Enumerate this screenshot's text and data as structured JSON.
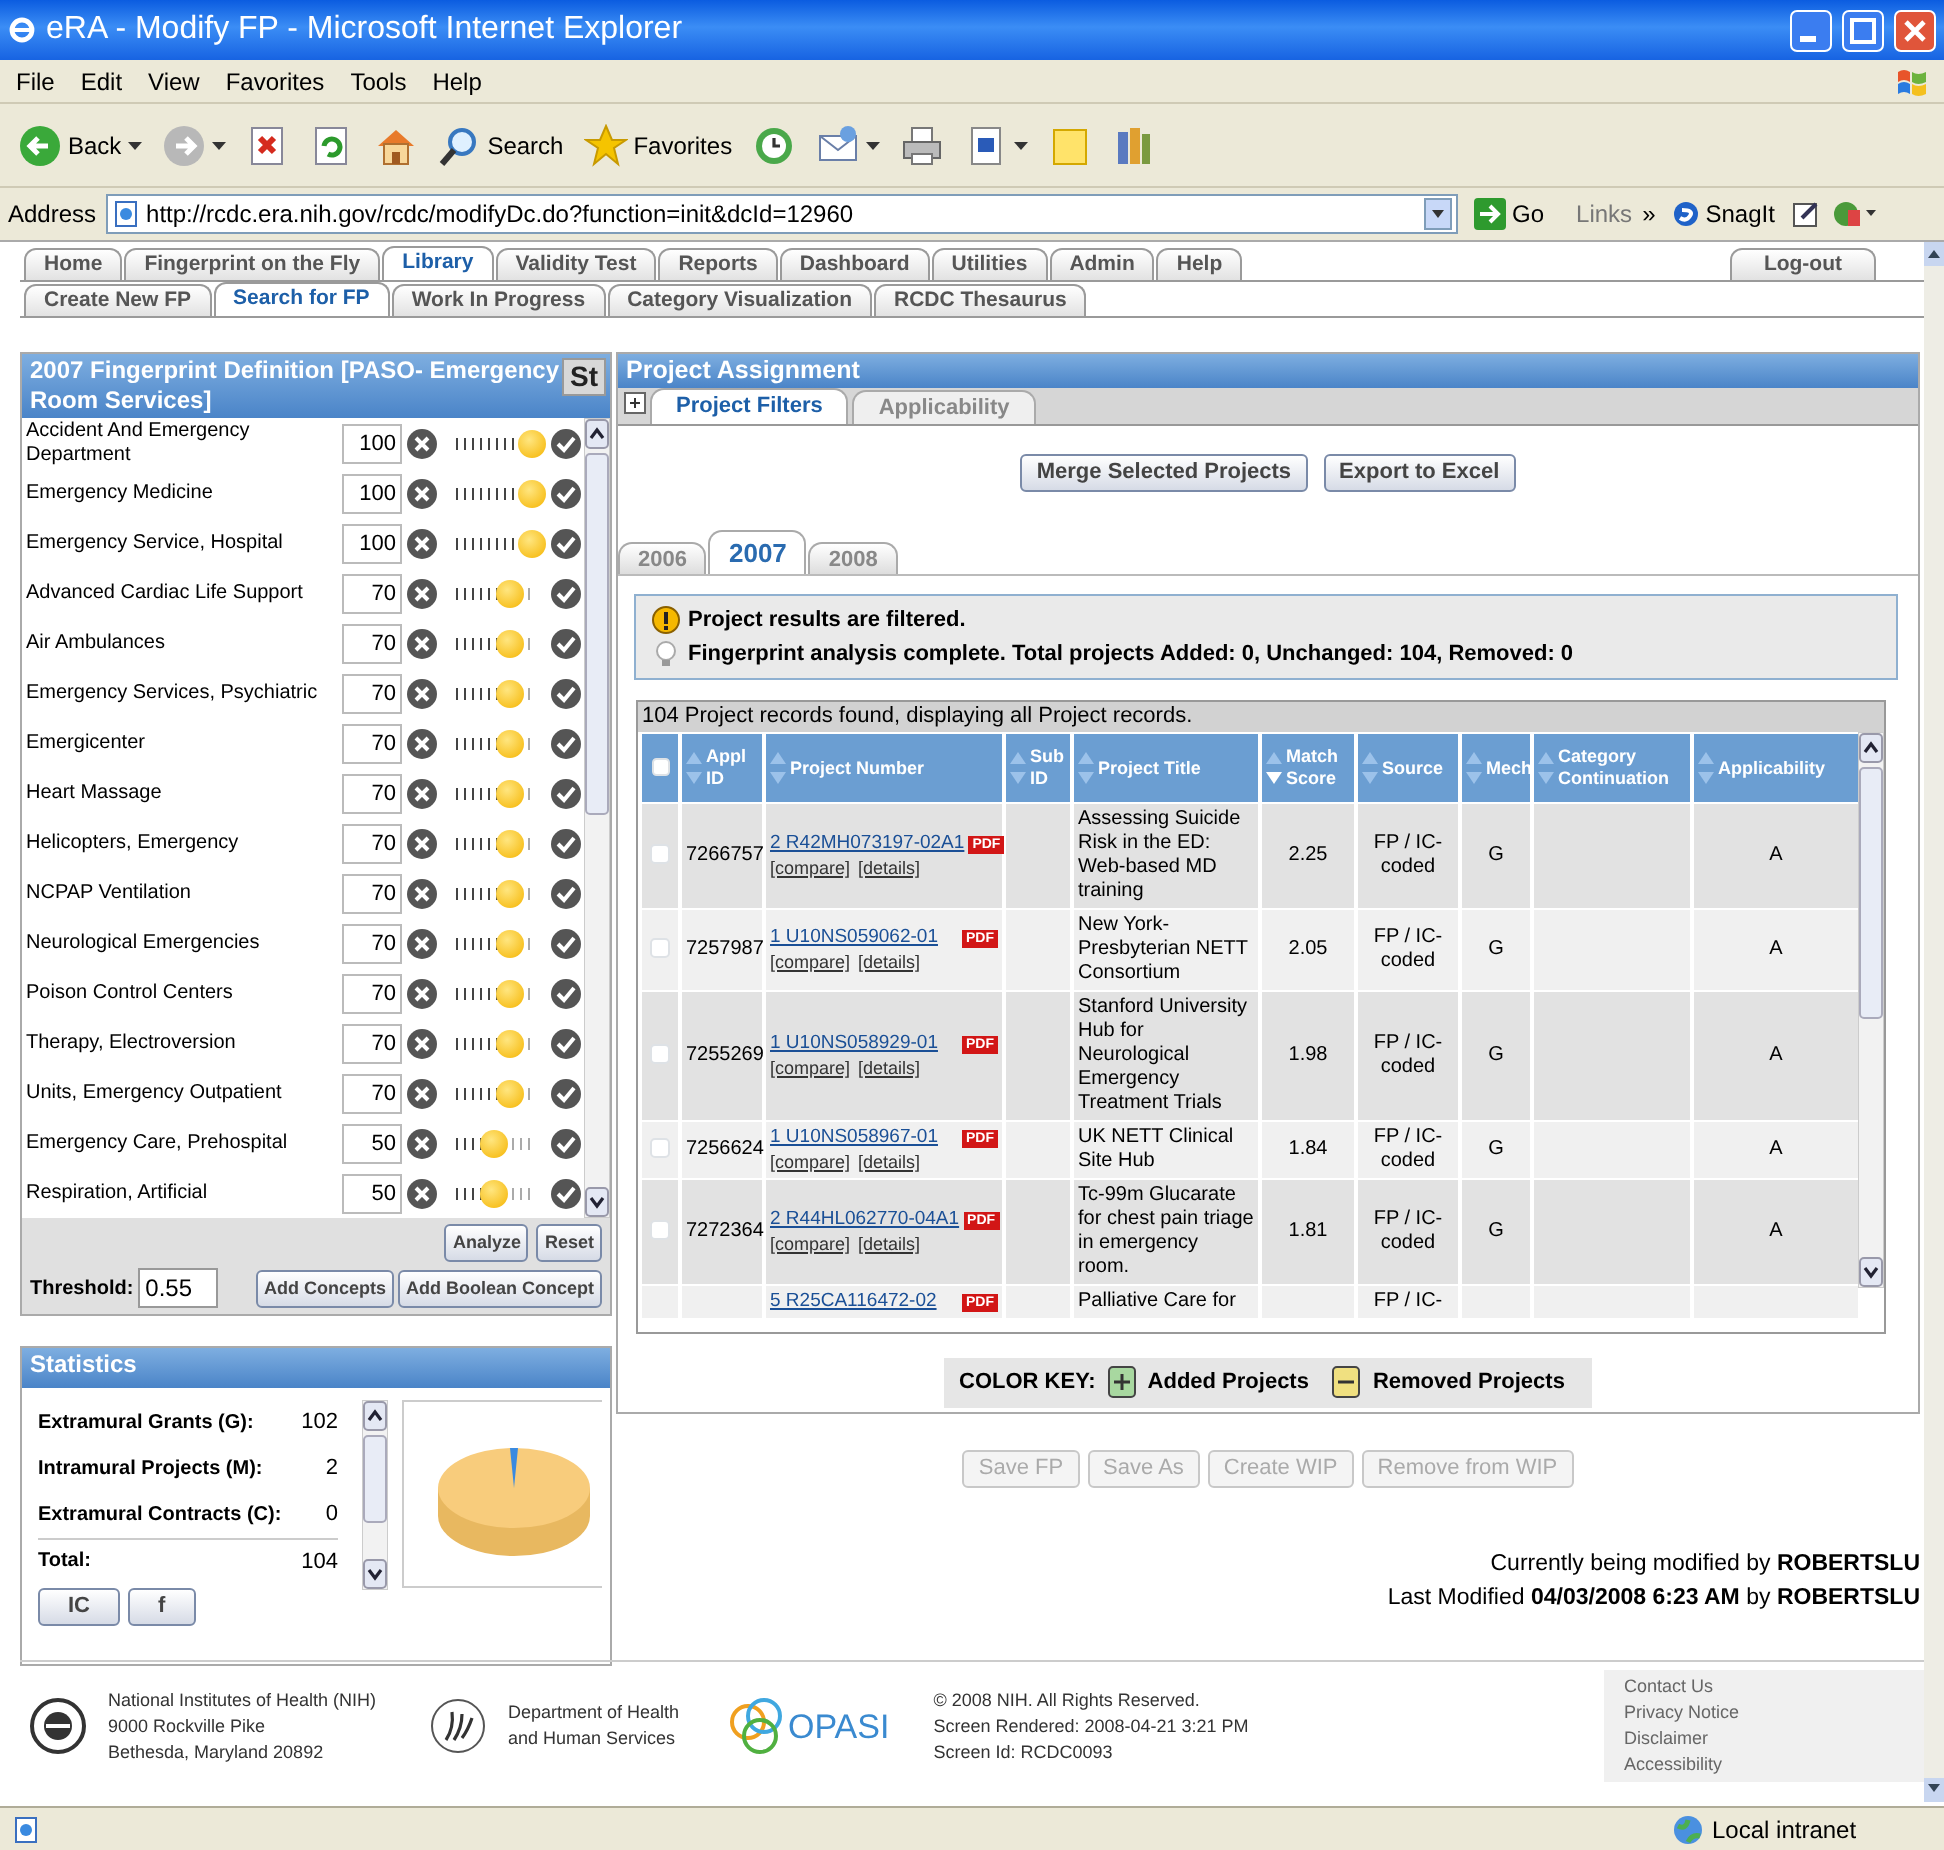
{
  "window": {
    "title": "eRA - Modify FP - Microsoft Internet Explorer"
  },
  "menu": [
    "File",
    "Edit",
    "View",
    "Favorites",
    "Tools",
    "Help"
  ],
  "toolbar": [
    {
      "kind": "back",
      "label": "Back",
      "menu": true
    },
    {
      "kind": "forward",
      "menu": true
    },
    {
      "kind": "stop",
      "menu": false
    },
    {
      "kind": "refresh",
      "menu": false
    },
    {
      "kind": "home",
      "menu": false
    },
    {
      "kind": "search",
      "label": "Search",
      "menu": false
    },
    {
      "kind": "favorites",
      "label": "Favorites",
      "menu": false
    },
    {
      "kind": "history",
      "menu": false
    },
    {
      "kind": "mail",
      "menu": true
    },
    {
      "kind": "print",
      "menu": false
    },
    {
      "kind": "word",
      "menu": true
    },
    {
      "kind": "note",
      "menu": false
    },
    {
      "kind": "research",
      "menu": false
    }
  ],
  "address": {
    "label": "Address",
    "url": "http://rcdc.era.nih.gov/rcdc/modifyDc.do?function=init&dcId=12960",
    "go": "Go",
    "links": "Links",
    "chevron": "»",
    "snagit": "SnagIt"
  },
  "nav_tabs": [
    {
      "label": "Home",
      "selected": false
    },
    {
      "label": "Fingerprint on the Fly",
      "selected": false
    },
    {
      "label": "Library",
      "selected": true
    },
    {
      "label": "Validity Test",
      "selected": false
    },
    {
      "label": "Reports",
      "selected": false
    },
    {
      "label": "Dashboard",
      "selected": false
    },
    {
      "label": "Utilities",
      "selected": false
    },
    {
      "label": "Admin",
      "selected": false
    },
    {
      "label": "Help",
      "selected": false
    }
  ],
  "logout": "Log-out",
  "sub_tabs": [
    {
      "label": "Create New FP",
      "selected": false
    },
    {
      "label": "Search for FP",
      "selected": true
    },
    {
      "label": "Work In Progress",
      "selected": false
    },
    {
      "label": "Category Visualization",
      "selected": false
    },
    {
      "label": "RCDC Thesaurus",
      "selected": false
    }
  ],
  "fingerprint": {
    "title": "2007 Fingerprint Definition [PASO- Emergency Room Services]",
    "side_button": "St",
    "concepts": [
      {
        "name": "Accident And Emergency Department",
        "value": "100",
        "level": 1
      },
      {
        "name": "Emergency Medicine",
        "value": "100",
        "level": 1
      },
      {
        "name": "Emergency Service, Hospital",
        "value": "100",
        "level": 1
      },
      {
        "name": "Advanced Cardiac Life Support",
        "value": "70",
        "level": 0.7
      },
      {
        "name": "Air Ambulances",
        "value": "70",
        "level": 0.7
      },
      {
        "name": "Emergency Services, Psychiatric",
        "value": "70",
        "level": 0.7
      },
      {
        "name": "Emergicenter",
        "value": "70",
        "level": 0.7
      },
      {
        "name": "Heart Massage",
        "value": "70",
        "level": 0.7
      },
      {
        "name": "Helicopters, Emergency",
        "value": "70",
        "level": 0.7
      },
      {
        "name": "NCPAP Ventilation",
        "value": "70",
        "level": 0.7
      },
      {
        "name": "Neurological Emergencies",
        "value": "70",
        "level": 0.7
      },
      {
        "name": "Poison Control Centers",
        "value": "70",
        "level": 0.7
      },
      {
        "name": "Therapy, Electroversion",
        "value": "70",
        "level": 0.7
      },
      {
        "name": "Units, Emergency Outpatient",
        "value": "70",
        "level": 0.7
      },
      {
        "name": "Emergency Care, Prehospital",
        "value": "50",
        "level": 0.5
      },
      {
        "name": "Respiration, Artificial",
        "value": "50",
        "level": 0.5
      }
    ],
    "threshold_label": "Threshold:",
    "threshold": "0.55",
    "buttons": [
      "Analyze",
      "Reset"
    ],
    "add_buttons": [
      "Add Concepts",
      "Add Boolean Concept"
    ]
  },
  "statistics": {
    "title": "Statistics",
    "rows": [
      {
        "label": "Extramural Grants (G):",
        "value": "102"
      },
      {
        "label": "Intramural Projects (M):",
        "value": "2"
      },
      {
        "label": "Extramural Contracts (C):",
        "value": "0"
      }
    ],
    "total": {
      "label": "Total:",
      "value": "104"
    },
    "buttons": [
      "IC",
      "f"
    ]
  },
  "assignment": {
    "title": "Project Assignment",
    "tabs": [
      {
        "label": "Project Filters",
        "selected": true
      },
      {
        "label": "Applicability",
        "selected": false
      }
    ],
    "buttons": [
      "Merge Selected Projects",
      "Export to Excel"
    ],
    "year_tabs": [
      {
        "label": "2006",
        "selected": false
      },
      {
        "label": "2007",
        "selected": true
      },
      {
        "label": "2008",
        "selected": false
      }
    ],
    "messages": [
      {
        "kind": "warning",
        "text": "Project results are filtered."
      },
      {
        "kind": "info",
        "text": "Fingerprint analysis complete. Total projects Added: 0, Unchanged: 104, Removed: 0"
      }
    ],
    "caption": "104 Project records found, displaying all Project records.",
    "select_all": {
      "checked": false
    },
    "columns": [
      {
        "label": "Appl ID",
        "sorted": false
      },
      {
        "label": "Project Number",
        "sorted": false
      },
      {
        "label": "Sub ID",
        "sorted": false
      },
      {
        "label": "Project Title",
        "sorted": false
      },
      {
        "label": "Match Score",
        "sorted": true
      },
      {
        "label": "Source",
        "sorted": false
      },
      {
        "label": "Mech",
        "sorted": false
      },
      {
        "label": "Category Continuation",
        "sorted": false
      },
      {
        "label": "Applicability",
        "sorted": false
      }
    ],
    "rows": [
      {
        "checked": false,
        "appl_id": "7266757",
        "project_number": "2 R42MH073197-02A1",
        "pdf": "PDF",
        "links": [
          "[compare]",
          "[details]"
        ],
        "title": "Assessing Suicide Risk in the ED: Web-based MD training",
        "match_score": "2.25",
        "source": "FP / IC-coded",
        "mech": "G",
        "applicability": "A"
      },
      {
        "checked": false,
        "appl_id": "7257987",
        "project_number": "1 U10NS059062-01",
        "pdf": "PDF",
        "links": [
          "[compare]",
          "[details]"
        ],
        "title": "New York-Presbyterian NETT Consortium",
        "match_score": "2.05",
        "source": "FP / IC-coded",
        "mech": "G",
        "applicability": "A"
      },
      {
        "checked": false,
        "appl_id": "7255269",
        "project_number": "1 U10NS058929-01",
        "pdf": "PDF",
        "links": [
          "[compare]",
          "[details]"
        ],
        "title": "Stanford University Hub for Neurological Emergency Treatment Trials",
        "match_score": "1.98",
        "source": "FP / IC-coded",
        "mech": "G",
        "applicability": "A"
      },
      {
        "checked": false,
        "appl_id": "7256624",
        "project_number": "1 U10NS058967-01",
        "pdf": "PDF",
        "links": [
          "[compare]",
          "[details]"
        ],
        "title": "UK NETT Clinical Site Hub",
        "match_score": "1.84",
        "source": "FP / IC-coded",
        "mech": "G",
        "applicability": "A"
      },
      {
        "checked": false,
        "appl_id": "7272364",
        "project_number": "2 R44HL062770-04A1",
        "pdf": "PDF",
        "links": [
          "[compare]",
          "[details]"
        ],
        "title": "Tc-99m Glucarate for chest pain triage in emergency room.",
        "match_score": "1.81",
        "source": "FP / IC-coded",
        "mech": "G",
        "applicability": "A"
      },
      {
        "project_number": "5 R25CA116472-02",
        "pdf": "PDF",
        "title": "Palliative Care for",
        "source": "FP / IC-"
      }
    ],
    "color_key": {
      "label": "COLOR KEY:",
      "items": [
        {
          "kind": "added",
          "label": "Added Projects"
        },
        {
          "kind": "removed",
          "label": "Removed Projects"
        }
      ]
    },
    "actions": [
      {
        "label": "Save FP",
        "disabled": true
      },
      {
        "label": "Save As",
        "disabled": true
      },
      {
        "label": "Create WIP",
        "disabled": true
      },
      {
        "label": "Remove from WIP",
        "disabled": true
      }
    ],
    "modified": [
      "Currently being modified by **ROBERTSLU**",
      "Last Modified **04/03/2008 6:23 AM** by **ROBERTSLU**"
    ]
  },
  "footer": {
    "nih": [
      "National Institutes of Health (NIH)",
      "9000 Rockville Pike",
      "Bethesda, Maryland 20892"
    ],
    "hhs": [
      "Department of Health",
      "and Human Services"
    ],
    "opasi": "OPASI",
    "info": [
      "© 2008 NIH. All Rights Reserved.",
      "Screen Rendered: 2008-04-21 3:21 PM",
      "Screen Id: RCDC0093"
    ],
    "links": [
      "Contact Us",
      "Privacy Notice",
      "Disclaimer",
      "Accessibility"
    ]
  },
  "status_bar": {
    "zone": "Local intranet"
  }
}
